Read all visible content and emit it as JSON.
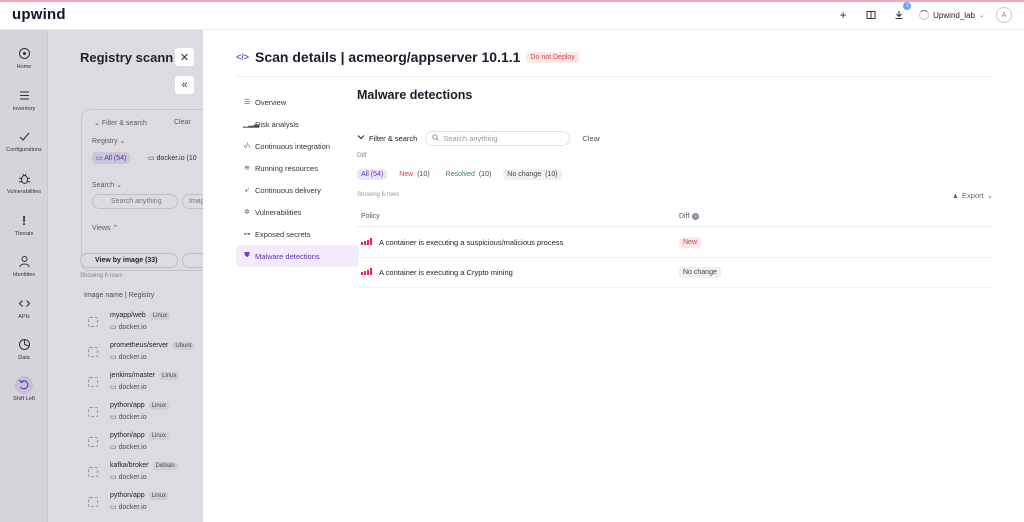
{
  "app": {
    "logo": "upwind",
    "account_name": "Upwind_lab",
    "notifications_count": "1",
    "avatar_initial": "A"
  },
  "leftnav": [
    {
      "label": "Home",
      "icon": "home-icon"
    },
    {
      "label": "Inventory",
      "icon": "inventory-icon"
    },
    {
      "label": "Configurations",
      "icon": "checkmark-icon"
    },
    {
      "label": "Vulnerabilities",
      "icon": "bug-icon"
    },
    {
      "label": "Threats",
      "icon": "exclamation-icon"
    },
    {
      "label": "Identities",
      "icon": "person-icon"
    },
    {
      "label": "APIs",
      "icon": "code-icon"
    },
    {
      "label": "Data",
      "icon": "pie-chart-icon"
    },
    {
      "label": "Shift Left",
      "icon": "undo-icon"
    }
  ],
  "background_page": {
    "title": "Registry scannin",
    "filter_search_label": "Filter & search",
    "clear_label": "Clear",
    "registry_label": "Registry",
    "all_chip": "All (54)",
    "docker_chip": "docker.io (10",
    "search_label": "Search",
    "search_placeholder": "Search anything",
    "image_placeholder": "Imag",
    "views_label": "Views",
    "view_by_image_tab": "View by image (33)",
    "showing_rows": "Showing 6 rows",
    "column_header": "Image name | Registry",
    "rows": [
      {
        "name": "myapp/web",
        "os": "Linux",
        "registry": "docker.io"
      },
      {
        "name": "prometheus/server",
        "os": "Ubunt",
        "registry": "docker.io"
      },
      {
        "name": "jenkins/master",
        "os": "Linux",
        "registry": "docker.io"
      },
      {
        "name": "python/app",
        "os": "Linux",
        "registry": "docker.io"
      },
      {
        "name": "python/app",
        "os": "Linux",
        "registry": "docker.io"
      },
      {
        "name": "kafka/broker",
        "os": "Debian",
        "registry": "docker.io"
      },
      {
        "name": "python/app",
        "os": "Linux",
        "registry": "docker.io"
      }
    ]
  },
  "drawer": {
    "title": "Scan details | acmeorg/appserver 10.1.1",
    "status_badge": "Do not Deploy",
    "section_nav": [
      {
        "label": "Overview",
        "icon": "list-icon"
      },
      {
        "label": "Risk analysis",
        "icon": "bar-chart-icon"
      },
      {
        "label": "Continuous integration",
        "icon": "code-icon"
      },
      {
        "label": "Running resources",
        "icon": "layers-icon"
      },
      {
        "label": "Continuous delivery",
        "icon": "rocket-icon"
      },
      {
        "label": "Vulnerabilities",
        "icon": "bug-icon"
      },
      {
        "label": "Exposed secrets",
        "icon": "key-icon"
      },
      {
        "label": "Malware detections",
        "icon": "shield-icon"
      }
    ],
    "active_section": "Malware detections",
    "content": {
      "title": "Malware detections",
      "filter_search_label": "Filter & search",
      "search_placeholder": "Search anything",
      "clear_label": "Clear",
      "diff_label": "Diff",
      "diff_chips": [
        {
          "label": "All",
          "count": "(54)"
        },
        {
          "label": "New",
          "count": "(10)"
        },
        {
          "label": "Resolved",
          "count": "(10)"
        },
        {
          "label": "No change",
          "count": "(10)"
        }
      ],
      "showing_rows": "Showing 6 rows",
      "export_label": "Export",
      "columns": {
        "policy": "Policy",
        "diff": "Diff"
      },
      "rows": [
        {
          "policy": "A container is executing a suspicious/malicious process",
          "diff": "New"
        },
        {
          "policy": "A container is executing a Crypto mining",
          "diff": "No change"
        }
      ]
    }
  },
  "colors": {
    "accent": "#6b3fc4",
    "danger": "#d63b3b",
    "success": "#2e8a5b",
    "severity": "#e0245e"
  }
}
